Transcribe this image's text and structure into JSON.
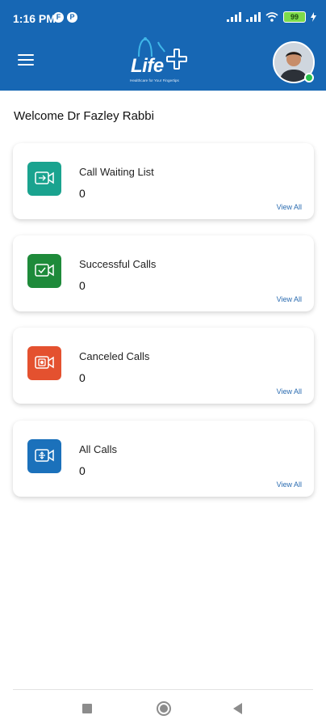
{
  "status_bar": {
    "time": "1:16 PM",
    "notif_icons": [
      "F",
      "P"
    ],
    "battery": "99"
  },
  "header": {
    "logo_text": "Life",
    "logo_tagline": "Healthcare for Your Fingertips",
    "menu_icon": "hamburger-icon",
    "brand_color": "#1767b4"
  },
  "welcome": "Welcome Dr Fazley Rabbi",
  "cards": [
    {
      "title": "Call Waiting List",
      "count": "0",
      "view_all": "View All",
      "color": "#1aa38f",
      "icon": "video-waiting-icon"
    },
    {
      "title": "Successful Calls",
      "count": "0",
      "view_all": "View All",
      "color": "#1e8a3a",
      "icon": "video-success-icon"
    },
    {
      "title": "Canceled Calls",
      "count": "0",
      "view_all": "View All",
      "color": "#e4512f",
      "icon": "video-cancel-icon"
    },
    {
      "title": "All Calls",
      "count": "0",
      "view_all": "View All",
      "color": "#1b71bb",
      "icon": "video-all-icon"
    }
  ],
  "nav": [
    "recent-apps-icon",
    "home-icon",
    "back-icon"
  ]
}
